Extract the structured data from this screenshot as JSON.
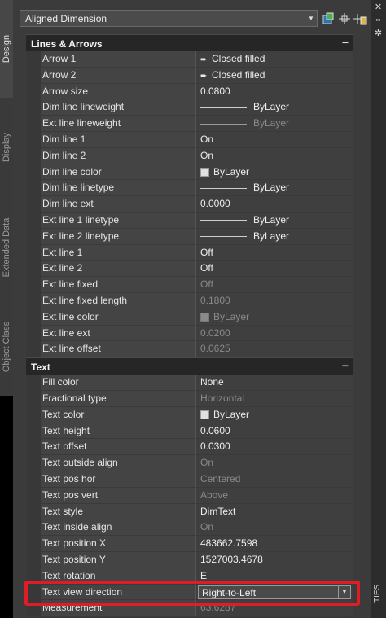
{
  "tabs": [
    "Design",
    "Display",
    "Extended Data",
    "Object Class"
  ],
  "right_strip": {
    "vertical_label": "TIES",
    "controls": [
      "✕",
      "⇔",
      "✲"
    ]
  },
  "object_select": {
    "value": "Aligned Dimension"
  },
  "toolbar_icons": [
    "quick-select-icon",
    "select-objects-icon",
    "toggle-pickadd-icon"
  ],
  "sections": [
    {
      "title": "Lines & Arrows",
      "collapse": "−",
      "rows": [
        {
          "name": "Arrow 1",
          "value": "Closed filled",
          "kind": "arrow"
        },
        {
          "name": "Arrow 2",
          "value": "Closed filled",
          "kind": "arrow"
        },
        {
          "name": "Arrow size",
          "value": "0.0800"
        },
        {
          "name": "Dim line lineweight",
          "value": "ByLayer",
          "kind": "line"
        },
        {
          "name": "Ext line lineweight",
          "value": "ByLayer",
          "kind": "line",
          "disabled": true
        },
        {
          "name": "Dim line 1",
          "value": "On"
        },
        {
          "name": "Dim line 2",
          "value": "On"
        },
        {
          "name": "Dim line color",
          "value": "ByLayer",
          "kind": "swatch"
        },
        {
          "name": "Dim line linetype",
          "value": "ByLayer",
          "kind": "line"
        },
        {
          "name": "Dim line ext",
          "value": "0.0000"
        },
        {
          "name": "Ext line 1 linetype",
          "value": "ByLayer",
          "kind": "line"
        },
        {
          "name": "Ext line 2 linetype",
          "value": "ByLayer",
          "kind": "line"
        },
        {
          "name": "Ext line 1",
          "value": "Off"
        },
        {
          "name": "Ext line 2",
          "value": "Off"
        },
        {
          "name": "Ext line fixed",
          "value": "Off",
          "disabled": true
        },
        {
          "name": "Ext line fixed length",
          "value": "0.1800",
          "disabled": true
        },
        {
          "name": "Ext line color",
          "value": "ByLayer",
          "kind": "swatch",
          "disabled": true
        },
        {
          "name": "Ext line ext",
          "value": "0.0200",
          "disabled": true
        },
        {
          "name": "Ext line offset",
          "value": "0.0625",
          "disabled": true
        }
      ]
    },
    {
      "title": "Text",
      "collapse": "−",
      "rows": [
        {
          "name": "Fill color",
          "value": "None"
        },
        {
          "name": "Fractional type",
          "value": "Horizontal",
          "disabled": true
        },
        {
          "name": "Text color",
          "value": "ByLayer",
          "kind": "swatch"
        },
        {
          "name": "Text height",
          "value": "0.0600"
        },
        {
          "name": "Text offset",
          "value": "0.0300"
        },
        {
          "name": "Text outside align",
          "value": "On",
          "disabled": true
        },
        {
          "name": "Text pos hor",
          "value": "Centered",
          "disabled": true
        },
        {
          "name": "Text pos vert",
          "value": "Above",
          "disabled": true
        },
        {
          "name": "Text style",
          "value": "DimText"
        },
        {
          "name": "Text inside align",
          "value": "On",
          "disabled": true
        },
        {
          "name": "Text position X",
          "value": "483662.7598"
        },
        {
          "name": "Text position Y",
          "value": "1527003.4678"
        },
        {
          "name": "Text rotation",
          "value": "E"
        },
        {
          "name": "Text view direction",
          "value": "Right-to-Left",
          "kind": "dropdown"
        },
        {
          "name": "Measurement",
          "value": "63.6287",
          "disabled": true
        }
      ]
    }
  ]
}
